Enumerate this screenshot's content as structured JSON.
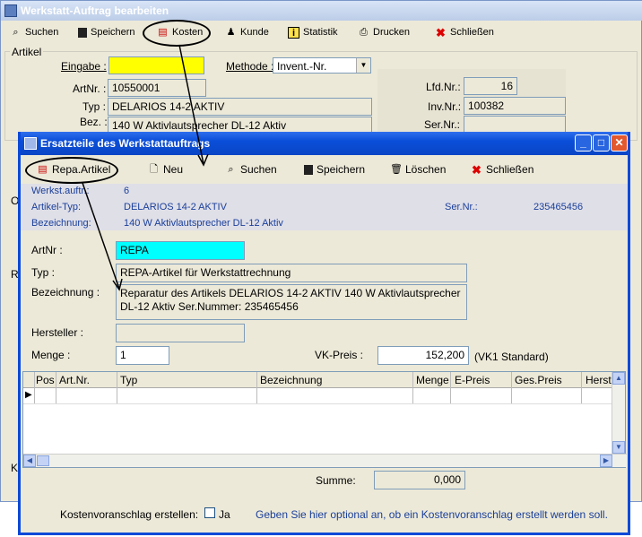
{
  "bg": {
    "title": "Werkstatt-Auftrag bearbeiten",
    "toolbar": [
      "Suchen",
      "Speichern",
      "Kosten",
      "Kunde",
      "Statistik",
      "Drucken",
      "Schließen"
    ],
    "group_artikel": "Artikel",
    "eingabe_label": "Eingabe :",
    "eingabe_value": "",
    "methode_label": "Methode :",
    "methode_value": "Invent.-Nr.",
    "artnr_label": "ArtNr. :",
    "artnr_value": "10550001",
    "typ_label": "Typ :",
    "typ_value": "DELARIOS 14-2 AKTIV",
    "bez_label": "Bez. :",
    "bez_value": "140 W Aktivlautsprecher DL-12 Aktiv",
    "lfdnr_label": "Lfd.Nr.:",
    "lfdnr_value": "16",
    "invnr_label": "Inv.Nr.:",
    "invnr_value": "100382",
    "sernr_label": "Ser.Nr.:",
    "sernr_value": "",
    "side_o": "O",
    "side_r": "R",
    "side_k": "K"
  },
  "fw": {
    "title": "Ersatzteile des Werkstattauftrags",
    "toolbar": [
      "Repa.Artikel",
      "Neu",
      "Suchen",
      "Speichern",
      "Löschen",
      "Schließen"
    ],
    "info": {
      "werkst_label": "Werkst.auftr.:",
      "werkst_value": "6",
      "typ_label": "Artikel-Typ:",
      "typ_value": "DELARIOS 14-2 AKTIV",
      "bez_label": "Bezeichnung:",
      "bez_value": "140 W Aktivlautsprecher DL-12 Aktiv",
      "sernr_label": "Ser.Nr.:",
      "sernr_value": "235465456"
    },
    "artnr_label": "ArtNr :",
    "artnr_value": "REPA",
    "typ_label": "Typ :",
    "typ_value": "REPA-Artikel für Werkstattrechnung",
    "bez_label": "Bezeichnung :",
    "bez_value": "Reparatur des Artikels DELARIOS 14-2 AKTIV 140 W Aktivlautsprecher DL-12 Aktiv Ser.Nummer: 235465456",
    "hersteller_label": "Hersteller :",
    "hersteller_value": "",
    "menge_label": "Menge :",
    "menge_value": "1",
    "vk_label": "VK-Preis :",
    "vk_value": "152,200",
    "vk_note": "(VK1 Standard)",
    "grid_headers": [
      "Pos",
      "Art.Nr.",
      "Typ",
      "Bezeichnung",
      "Menge",
      "E-Preis",
      "Ges.Preis",
      "Herste"
    ],
    "summe_label": "Summe:",
    "summe_value": "0,000",
    "kv_label": "Kostenvoranschlag erstellen:",
    "kv_check": "Ja",
    "kv_hint": "Geben Sie hier optional an, ob ein Kostenvoranschlag erstellt werden soll."
  },
  "colors": {
    "title_blue": "#0a4ed8",
    "eingabe_bg": "#ffff00",
    "artnr_bg": "#00ffff",
    "info_text": "#1a3f9a"
  }
}
